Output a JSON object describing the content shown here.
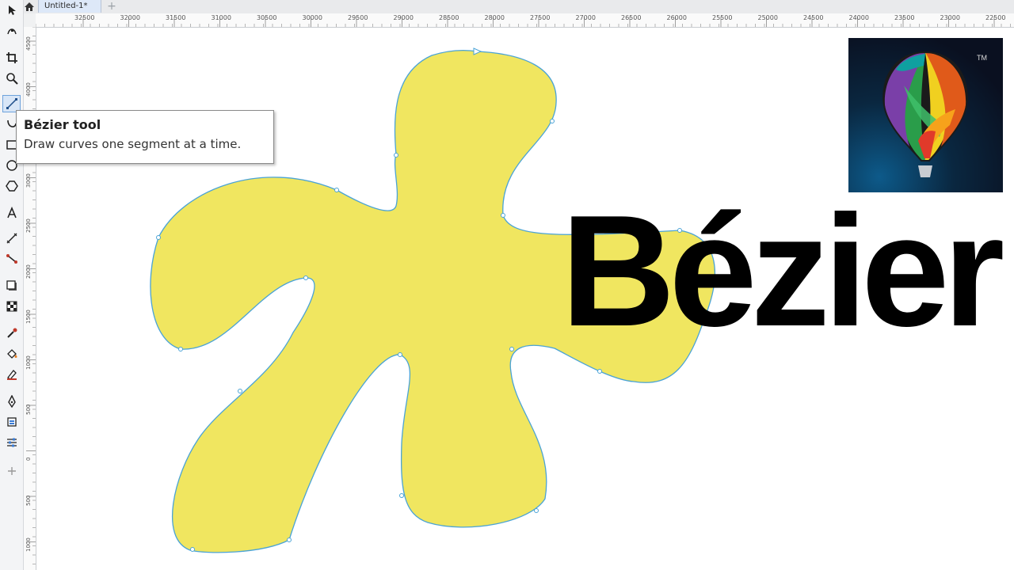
{
  "document": {
    "tab_title": "Untitled-1*"
  },
  "ruler": {
    "top_labels": [
      "32500",
      "32000",
      "31500",
      "31000",
      "30500",
      "30000",
      "29500",
      "29000",
      "28500",
      "28000",
      "27500",
      "27000",
      "26500",
      "26000",
      "25500",
      "25000",
      "24500",
      "24000",
      "23500",
      "23000",
      "22500"
    ],
    "left_labels": [
      "4500",
      "4000",
      "3500",
      "3000",
      "2500",
      "2000",
      "1500",
      "1000",
      "500",
      "0",
      "500",
      "1000"
    ]
  },
  "tooltip": {
    "title": "Bézier tool",
    "description": "Draw curves one segment at a time."
  },
  "headline": "Bézier",
  "logo": {
    "trademark": "TM"
  },
  "colors": {
    "shape_fill": "#f0e660",
    "shape_stroke": "#4aa3d6",
    "active_tool": "#d8e6f7"
  },
  "tools": [
    {
      "name": "pick-tool-icon",
      "active": false
    },
    {
      "name": "shape-tool-icon",
      "active": false
    },
    {
      "name": "crop-tool-icon",
      "active": false
    },
    {
      "name": "zoom-tool-icon",
      "active": false
    },
    {
      "name": "bezier-tool-icon",
      "active": true
    },
    {
      "name": "artistic-media-icon",
      "active": false
    },
    {
      "name": "rectangle-tool-icon",
      "active": false
    },
    {
      "name": "ellipse-tool-icon",
      "active": false
    },
    {
      "name": "polygon-tool-icon",
      "active": false
    },
    {
      "name": "text-tool-icon",
      "active": false
    },
    {
      "name": "parallel-dimension-icon",
      "active": false
    },
    {
      "name": "connector-tool-icon",
      "active": false
    },
    {
      "name": "drop-shadow-icon",
      "active": false
    },
    {
      "name": "transparency-icon",
      "active": false
    },
    {
      "name": "color-eyedropper-icon",
      "active": false
    },
    {
      "name": "interactive-fill-icon",
      "active": false
    },
    {
      "name": "smart-fill-icon",
      "active": false
    },
    {
      "name": "outline-pen-icon",
      "active": false
    },
    {
      "name": "paintbucket-icon",
      "active": false
    },
    {
      "name": "properties-icon",
      "active": false
    },
    {
      "name": "add-tool-icon",
      "active": false
    }
  ]
}
